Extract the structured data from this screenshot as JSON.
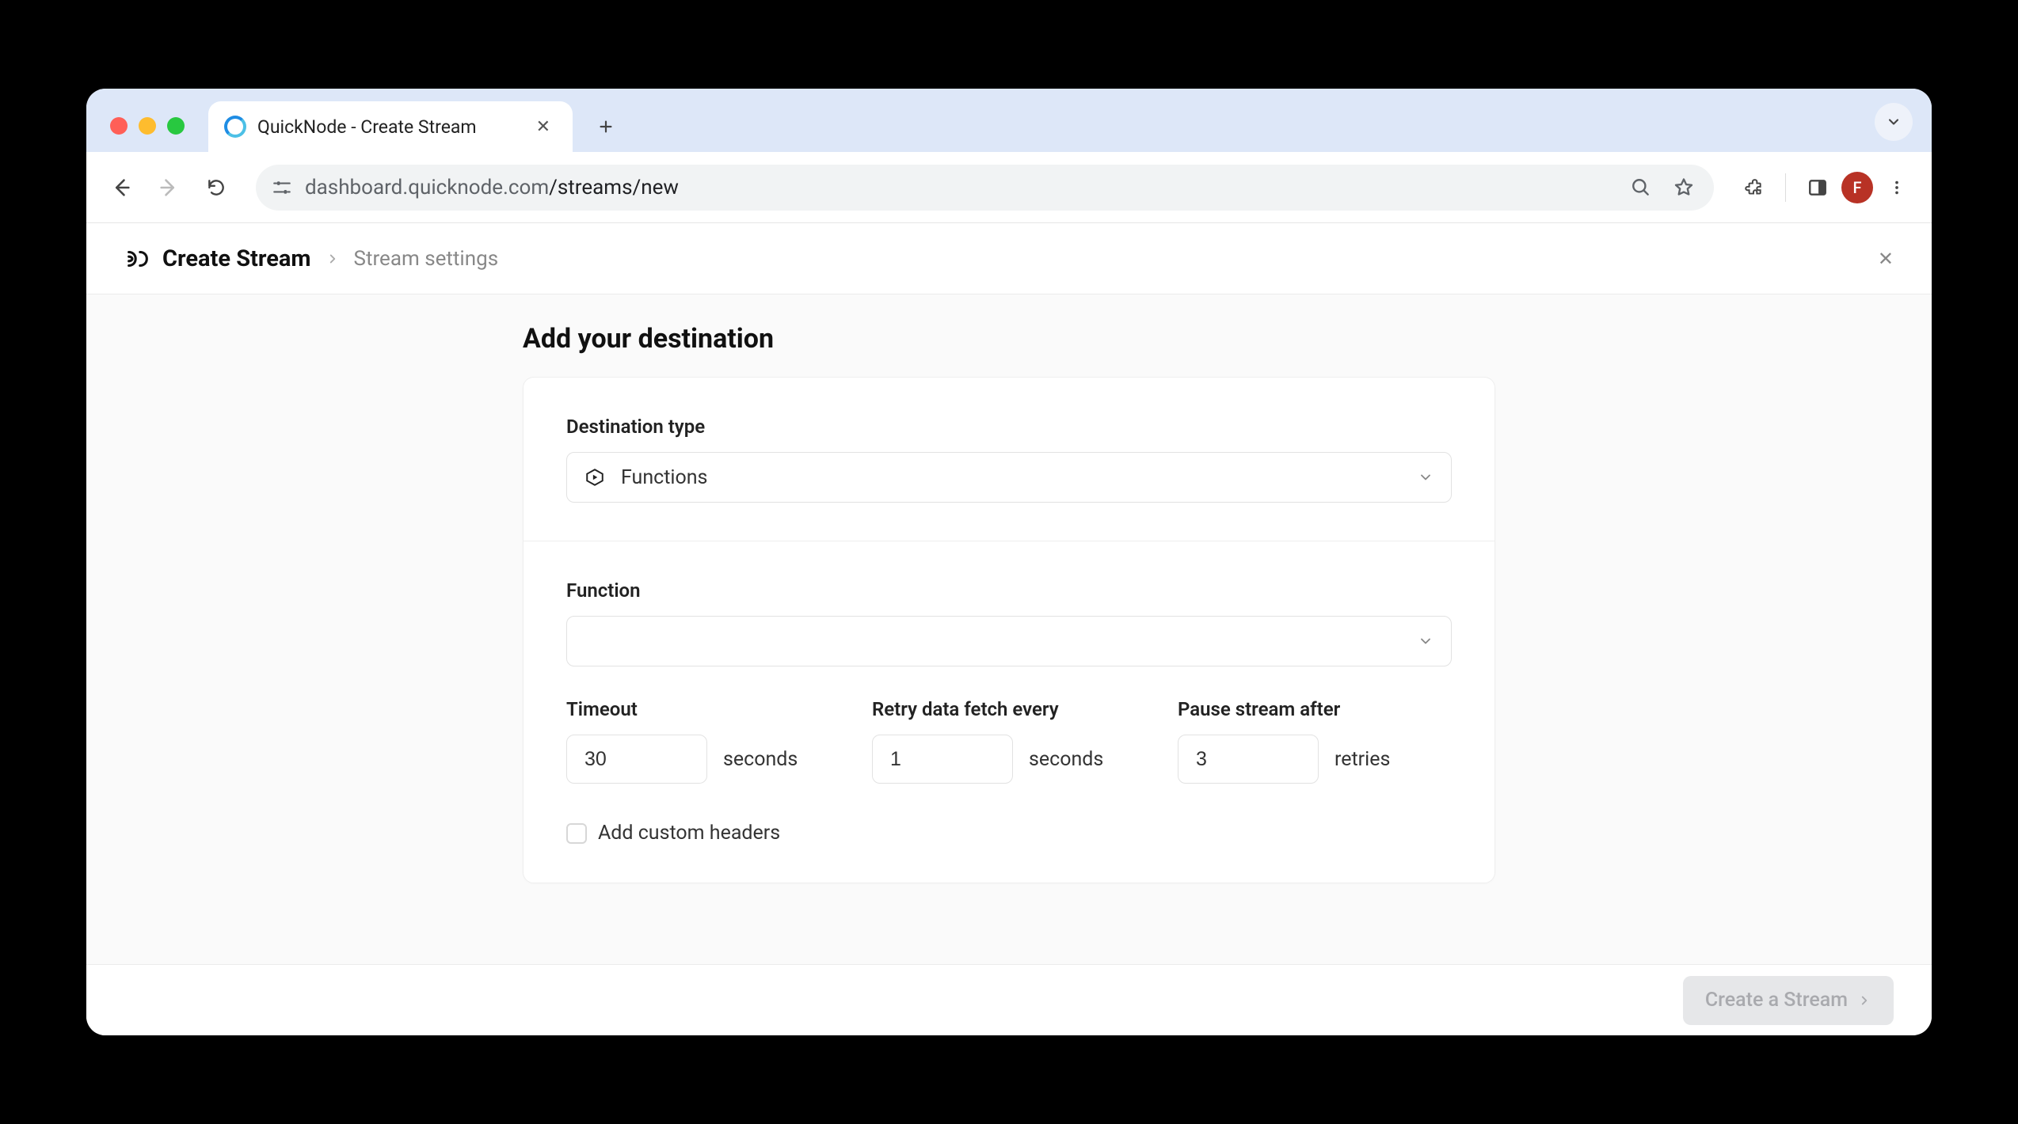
{
  "browser": {
    "tab_title": "QuickNode - Create Stream",
    "url_host": "dashboard.quicknode.com",
    "url_path": "/streams/new",
    "profile_initial": "F"
  },
  "header": {
    "title": "Create Stream",
    "subtitle": "Stream settings"
  },
  "page": {
    "title": "Add your destination"
  },
  "form": {
    "destination_type_label": "Destination type",
    "destination_type_value": "Functions",
    "function_label": "Function",
    "function_value": "",
    "timeout_label": "Timeout",
    "timeout_value": "30",
    "timeout_unit": "seconds",
    "retry_label": "Retry data fetch every",
    "retry_value": "1",
    "retry_unit": "seconds",
    "pause_label": "Pause stream after",
    "pause_value": "3",
    "pause_unit": "retries",
    "custom_headers_label": "Add custom headers"
  },
  "footer": {
    "submit_label": "Create a Stream"
  }
}
